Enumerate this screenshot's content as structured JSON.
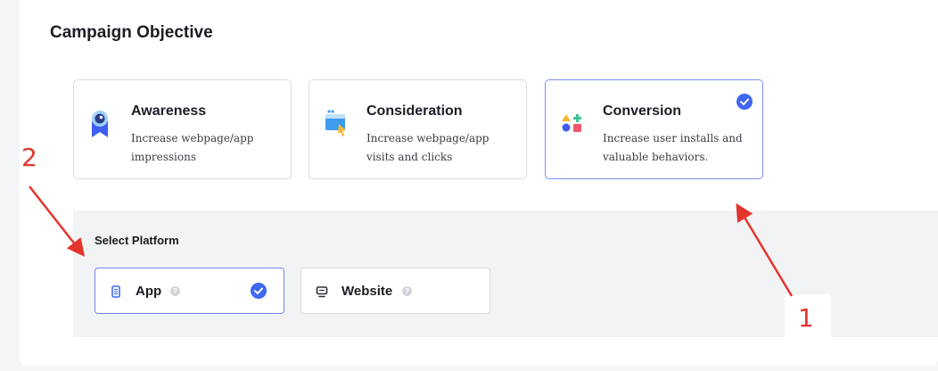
{
  "objective": {
    "title": "Campaign Objective",
    "cards": [
      {
        "title": "Awareness",
        "description": "Increase webpage/app impressions",
        "icon": "awareness-icon",
        "selected": false
      },
      {
        "title": "Consideration",
        "description": "Increase webpage/app visits and clicks",
        "icon": "consideration-icon",
        "selected": false
      },
      {
        "title": "Conversion",
        "description": "Increase user installs and valuable behaviors.",
        "icon": "conversion-icon",
        "selected": true
      }
    ]
  },
  "platform": {
    "title": "Select Platform",
    "options": [
      {
        "label": "App",
        "icon": "mobile-app-icon",
        "selected": true
      },
      {
        "label": "Website",
        "icon": "monitor-icon",
        "selected": false
      }
    ]
  },
  "annotations": {
    "label_1": "1",
    "label_2": "2",
    "color": "#e2352d"
  },
  "colors": {
    "accent": "#3f68f3",
    "selected_border": "#7d8ff0",
    "panel_bg": "#f2f3f5"
  }
}
